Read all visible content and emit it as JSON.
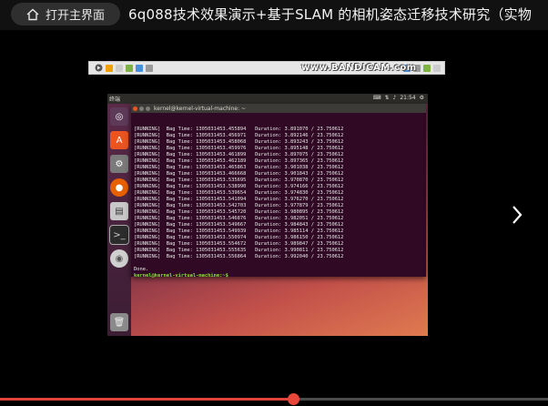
{
  "top_bar": {
    "home_label": "打开主界面",
    "title": "6q088技术效果演示+基于SLAM 的相机姿态迁移技术研究（实物"
  },
  "recorder": {
    "watermark": "www.BANDICAM.com"
  },
  "desktop": {
    "topbar_left": "终端",
    "clock": "21:54",
    "terminal": {
      "title": "kernel@kernel-virtual-machine: ~",
      "lines": [
        "[RUNNING]  Bag Time: 1305031453.455894   Duration: 3.891070 / 23.750612",
        "[RUNNING]  Bag Time: 1305031453.456971   Duration: 3.892146 / 23.750612",
        "[RUNNING]  Bag Time: 1305031453.458068   Duration: 3.893243 / 23.750612",
        "[RUNNING]  Bag Time: 1305031453.459976   Duration: 3.895148 / 23.750612",
        "[RUNNING]  Bag Time: 1305031453.461899   Duration: 3.897075 / 23.750612",
        "[RUNNING]  Bag Time: 1305031453.462189   Duration: 3.897365 / 23.750612",
        "[RUNNING]  Bag Time: 1305031453.465863   Duration: 3.901038 / 23.750612",
        "[RUNNING]  Bag Time: 1305031453.466668   Duration: 3.901843 / 23.750612",
        "[RUNNING]  Bag Time: 1305031453.535695   Duration: 3.970870 / 23.750612",
        "[RUNNING]  Bag Time: 1305031453.538990   Duration: 3.974166 / 23.750612",
        "[RUNNING]  Bag Time: 1305031453.539654   Duration: 3.974830 / 23.750612",
        "[RUNNING]  Bag Time: 1305031453.541094   Duration: 3.976270 / 23.750612",
        "[RUNNING]  Bag Time: 1305031453.542703   Duration: 3.977879 / 23.750612",
        "[RUNNING]  Bag Time: 1305031453.545720   Duration: 3.980895 / 23.750612",
        "[RUNNING]  Bag Time: 1305031453.546876   Duration: 3.982051 / 23.750612",
        "[RUNNING]  Bag Time: 1305031453.549667   Duration: 3.984843 / 23.750612",
        "[RUNNING]  Bag Time: 1305031453.549939   Duration: 3.985114 / 23.750612",
        "[RUNNING]  Bag Time: 1305031453.550974   Duration: 3.986150 / 23.750612",
        "[RUNNING]  Bag Time: 1305031453.554672   Duration: 3.989847 / 23.750612",
        "[RUNNING]  Bag Time: 1305031453.555635   Duration: 3.990811 / 23.750612",
        "[RUNNING]  Bag Time: 1305031453.556864   Duration: 3.992040 / 23.750612",
        "",
        "Done."
      ],
      "prompt": "kernel@kernel-virtual-machine:~$"
    }
  },
  "progress": {
    "played_fraction": 0.535
  },
  "colors": {
    "accent": "#e0443a",
    "terminal_bg": "#300a24"
  }
}
